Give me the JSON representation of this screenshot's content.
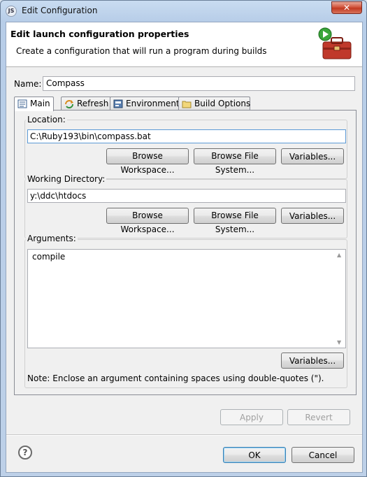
{
  "window": {
    "title": "Edit Configuration",
    "close_glyph": "✕"
  },
  "header": {
    "title": "Edit launch configuration properties",
    "description": "Create a configuration that will run a program during builds",
    "graphic": "toolbox-run-icon"
  },
  "name": {
    "label": "Name:",
    "value": "Compass"
  },
  "tabs": [
    {
      "label": "Main",
      "icon": "main-tab-icon",
      "active": true
    },
    {
      "label": "Refresh",
      "icon": "refresh-icon",
      "active": false
    },
    {
      "label": "Environment",
      "icon": "environment-icon",
      "active": false
    },
    {
      "label": "Build Options",
      "icon": "folder-icon",
      "active": false
    }
  ],
  "location": {
    "label": "Location:",
    "value": "C:\\Ruby193\\bin\\compass.bat",
    "browse_workspace": "Browse Workspace...",
    "browse_file_system": "Browse File System...",
    "variables": "Variables..."
  },
  "working_directory": {
    "label": "Working Directory:",
    "value": "y:\\ddc\\htdocs",
    "browse_workspace": "Browse Workspace...",
    "browse_file_system": "Browse File System...",
    "variables": "Variables..."
  },
  "arguments": {
    "label": "Arguments:",
    "value": "compile",
    "variables": "Variables...",
    "note": "Note: Enclose an argument containing spaces using double-quotes (\")."
  },
  "actions": {
    "apply": "Apply",
    "revert": "Revert",
    "ok": "OK",
    "cancel": "Cancel",
    "help": "?"
  },
  "colors": {
    "accent": "#3c7fb1",
    "close": "#c23a22"
  }
}
